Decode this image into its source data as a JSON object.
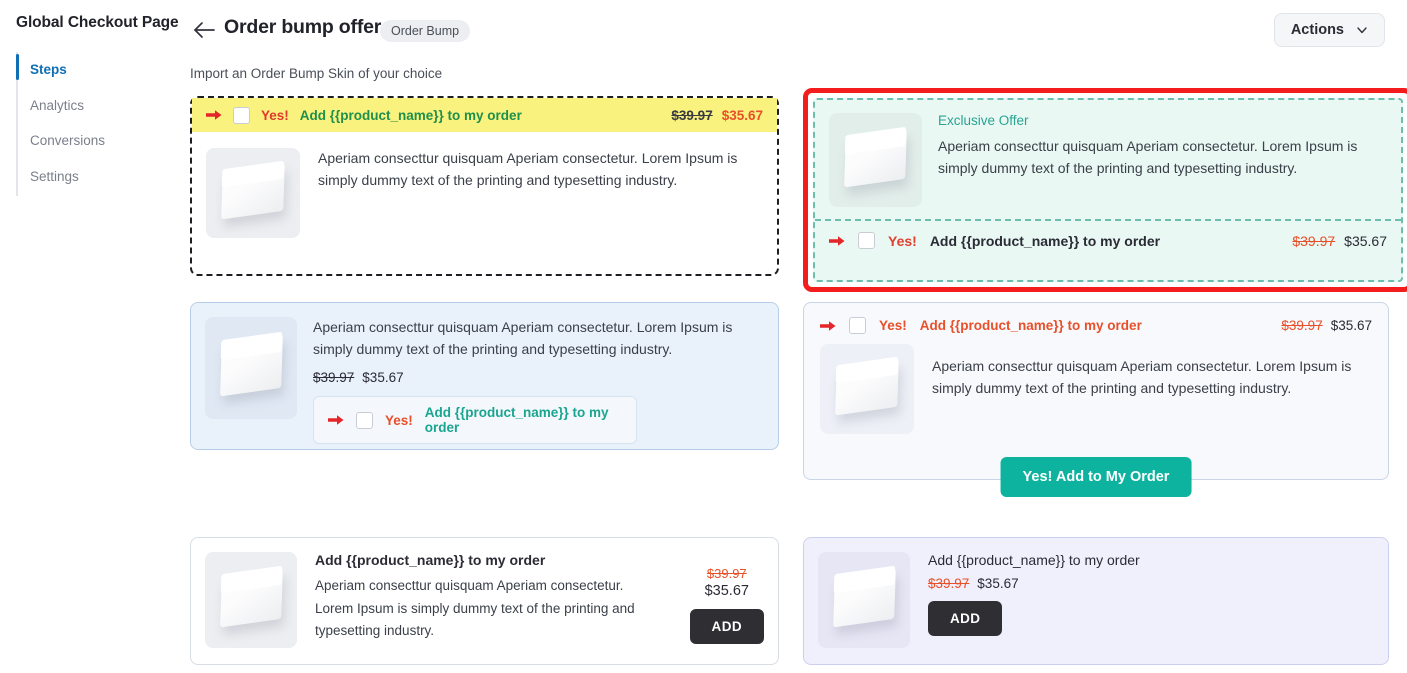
{
  "sidebar": {
    "title": "Global Checkout Page",
    "items": [
      {
        "label": "Steps",
        "active": true
      },
      {
        "label": "Analytics",
        "active": false
      },
      {
        "label": "Conversions",
        "active": false
      },
      {
        "label": "Settings",
        "active": false
      }
    ]
  },
  "header": {
    "back_icon": "arrow-left-icon",
    "title": "Order bump offer",
    "badge": "Order Bump",
    "actions_label": "Actions",
    "actions_icon": "chevron-down-icon"
  },
  "subtitle": "Import an Order Bump Skin of your choice",
  "common": {
    "description": "Aperiam consecttur quisquam Aperiam consectetur. Lorem Ipsum is simply dummy text of the printing and typesetting industry.",
    "old_price": "$39.97",
    "new_price": "$35.67",
    "arrow_icon": "arrow-right-icon",
    "checkbox_icon": "checkbox-unchecked-icon",
    "thumbnail_icon": "product-box-image"
  },
  "skins": [
    {
      "id": "skin-1",
      "name": "yellow-dashed-skin",
      "selected": false,
      "yes_text": "Yes!",
      "offer_text": "Add {{product_name}} to my order",
      "description": "Aperiam consecttur quisquam Aperiam consectetur. Lorem Ipsum is simply dummy text of the printing and typesetting industry.",
      "old_price": "$39.97",
      "new_price": "$35.67",
      "accent_bar": "#faf27e",
      "yes_color": "#e03a2f",
      "offer_color": "#1e8f4c",
      "new_price_color": "#e8502a"
    },
    {
      "id": "skin-2",
      "name": "exclusive-offer-mint-skin",
      "selected": true,
      "heading": "Exclusive Offer",
      "yes_text": "Yes!",
      "offer_text": "Add {{product_name}} to my order",
      "description": "Aperiam consecttur quisquam Aperiam consectetur. Lorem Ipsum is simply dummy text of the printing and typesetting industry.",
      "old_price": "$39.97",
      "new_price": "$35.67",
      "background": "#e9f8f3",
      "border_color": "#6cbfae",
      "selection_color": "#f41d1d",
      "heading_color": "#2aa393"
    },
    {
      "id": "skin-3",
      "name": "blue-panel-skin",
      "selected": false,
      "yes_text": "Yes!",
      "offer_text": "Add {{product_name}} to my order",
      "description": "Aperiam consecttur quisquam Aperiam consectetur. Lorem Ipsum is simply dummy text of the printing and typesetting industry.",
      "old_price": "$39.97",
      "new_price": "$35.67",
      "background": "#e9f1fb",
      "yes_color": "#e8502a",
      "offer_color": "#1aa58f"
    },
    {
      "id": "skin-4",
      "name": "teal-cta-skin",
      "selected": false,
      "yes_text": "Yes!",
      "offer_text": "Add {{product_name}} to my order",
      "description": "Aperiam consecttur quisquam Aperiam consectetur. Lorem Ipsum is simply dummy text of the printing and typesetting industry.",
      "old_price": "$39.97",
      "new_price": "$35.67",
      "cta_label": "Yes! Add to My Order",
      "cta_color": "#0db39e",
      "background": "#f7f9fd"
    },
    {
      "id": "skin-5",
      "name": "plain-add-button-skin",
      "selected": false,
      "title": "Add {{product_name}} to my order",
      "description": "Aperiam consecttur quisquam Aperiam consectetur. Lorem Ipsum is simply dummy text of the printing and typesetting industry.",
      "old_price": "$39.97",
      "new_price": "$35.67",
      "add_label": "ADD",
      "add_color": "#2e2e33",
      "background": "#ffffff"
    },
    {
      "id": "skin-6",
      "name": "lavender-add-button-skin",
      "selected": false,
      "title": "Add {{product_name}} to my order",
      "old_price": "$39.97",
      "new_price": "$35.67",
      "add_label": "ADD",
      "add_color": "#2e2e33",
      "background": "#f0f0fd"
    }
  ]
}
